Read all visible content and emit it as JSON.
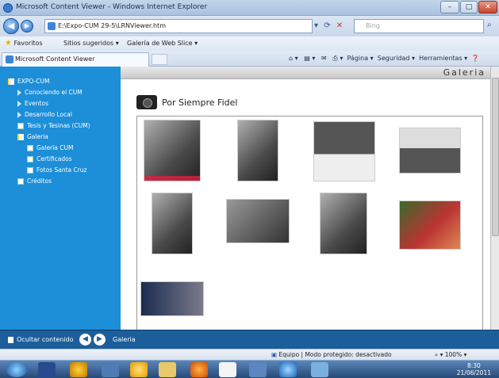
{
  "window": {
    "title": "Microsoft Content Viewer - Windows Internet Explorer",
    "minimize": "–",
    "maximize": "□",
    "close": "✕"
  },
  "address": {
    "url": "E:\\Expo-CUM 29-5\\LRNViewer.htm",
    "search_placeholder": "Bing"
  },
  "favorites_bar": {
    "favorites": "Favoritos",
    "suggested": "Sitios sugeridos ▾",
    "webslice": "Galería de Web Slice ▾"
  },
  "tab": {
    "label": "Microsoft Content Viewer"
  },
  "command_bar": {
    "page": "Página ▾",
    "security": "Seguridad ▾",
    "tools": "Herramientas ▾"
  },
  "sidebar": {
    "items": [
      {
        "label": "EXPO-CUM",
        "icon": "book-icon",
        "indent": 0
      },
      {
        "label": "Conociendo el CUM",
        "icon": "arrow-icon",
        "indent": 1
      },
      {
        "label": "Eventos",
        "icon": "arrow-icon",
        "indent": 1
      },
      {
        "label": "Desarrollo Local",
        "icon": "arrow-icon",
        "indent": 1
      },
      {
        "label": "Tesis y Tesinas (CUM)",
        "icon": "page-icon",
        "indent": 1
      },
      {
        "label": "Galeria",
        "icon": "book-icon",
        "indent": 1
      },
      {
        "label": "Galeria CUM",
        "icon": "page-icon",
        "indent": 2
      },
      {
        "label": "Certificados",
        "icon": "page-icon",
        "indent": 2
      },
      {
        "label": "Fotos Santa Cruz",
        "icon": "page-icon",
        "indent": 2
      },
      {
        "label": "Créditos",
        "icon": "page-icon",
        "indent": 1
      }
    ]
  },
  "content": {
    "page_title": "Galeria",
    "gallery_title": "Por Siempre Fidel",
    "photos": [
      {
        "alt": "photo-1"
      },
      {
        "alt": "photo-2"
      },
      {
        "alt": "photo-3"
      },
      {
        "alt": "photo-4"
      },
      {
        "alt": "photo-5"
      },
      {
        "alt": "photo-6"
      },
      {
        "alt": "photo-7"
      },
      {
        "alt": "photo-8"
      },
      {
        "alt": "photo-9"
      }
    ]
  },
  "controls": {
    "hide_contents": "Ocultar contenido",
    "current": "Galeria"
  },
  "status": {
    "zone": "Equipo | Modo protegido: desactivado",
    "zoom": "100%"
  },
  "clock": {
    "time": "8:30",
    "date": "21/06/2011"
  }
}
